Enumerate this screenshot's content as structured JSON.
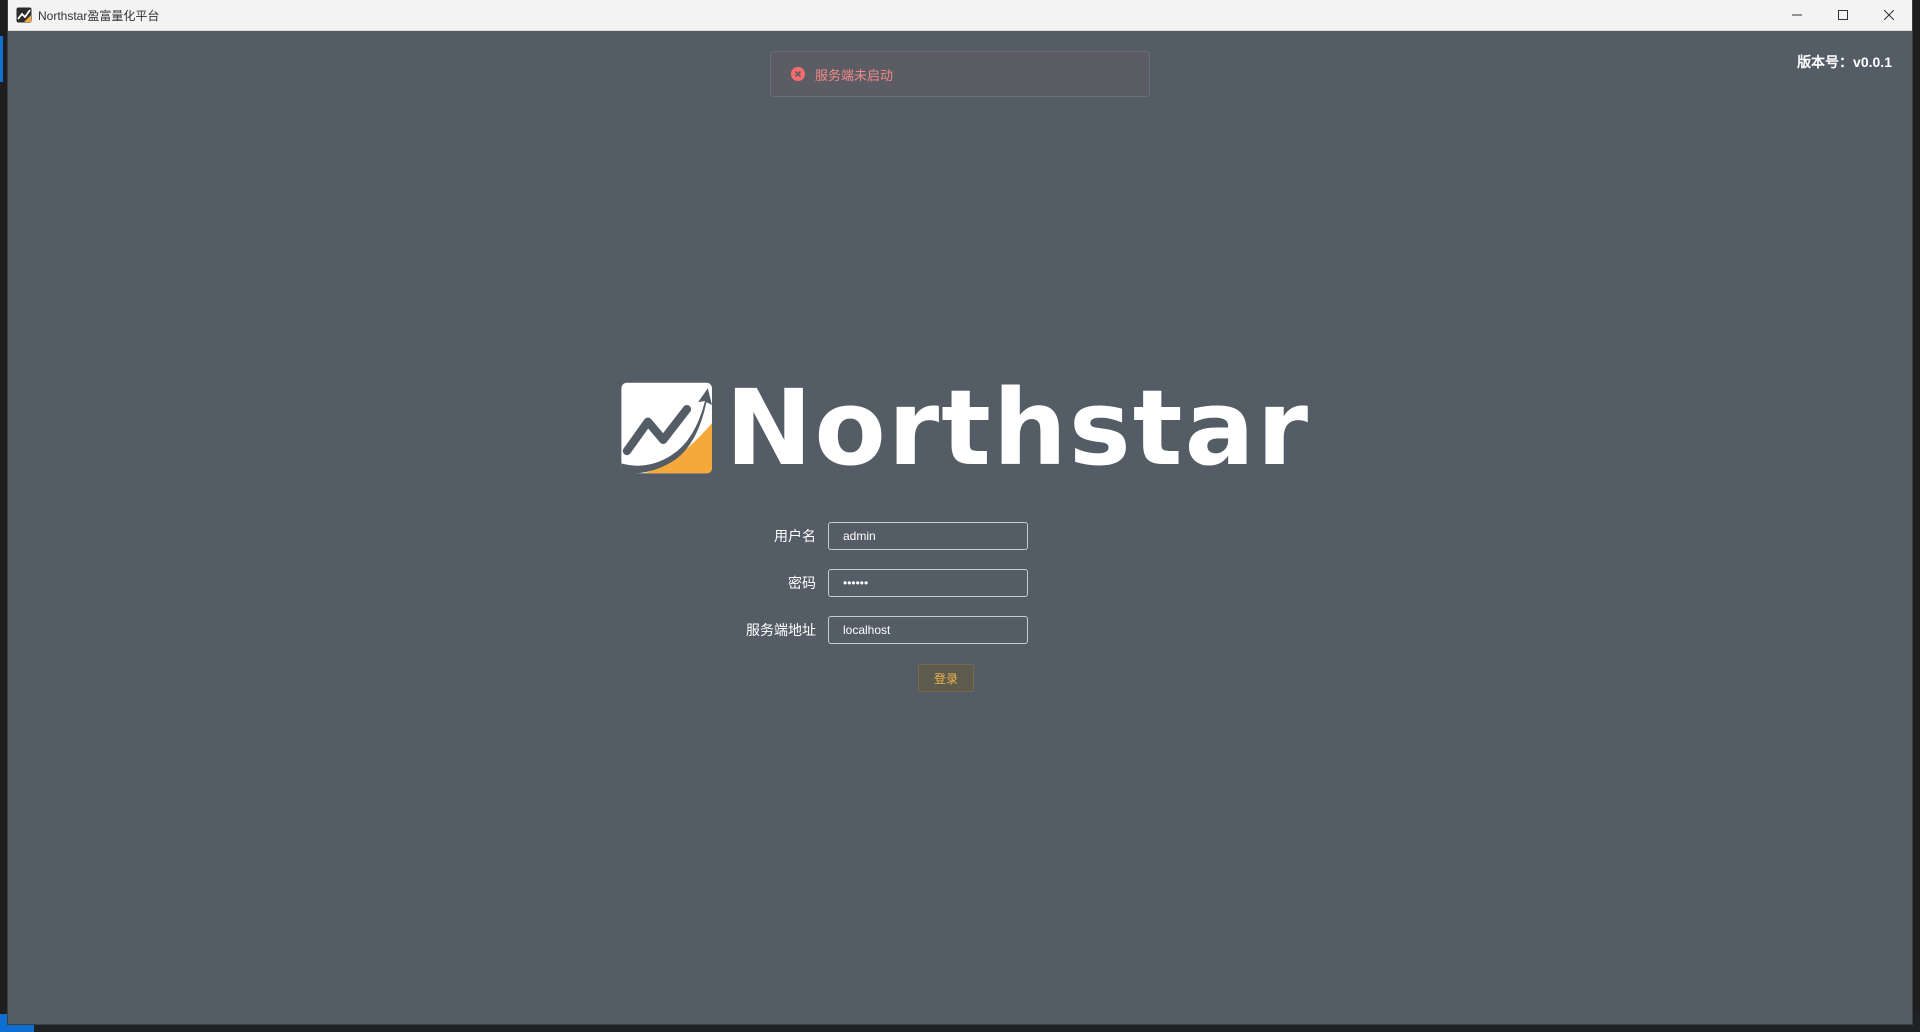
{
  "window": {
    "title": "Northstar盈富量化平台",
    "controls": [
      "minimize",
      "maximize",
      "close"
    ]
  },
  "header": {
    "version_label": "版本号：v0.0.1"
  },
  "toast": {
    "type": "error",
    "message": "服务端未启动",
    "icon": "error-circle-icon",
    "color": "#f56c6c"
  },
  "logo": {
    "wordmark": "Northstar",
    "mark_icon": "rising-chart-icon",
    "accent": "#f5a93b"
  },
  "form": {
    "username": {
      "label": "用户名",
      "value": "admin"
    },
    "password": {
      "label": "密码",
      "value": "••••••"
    },
    "server": {
      "label": "服务端地址",
      "value": "localhost"
    },
    "submit_label": "登录"
  },
  "colors": {
    "background": "#545c66",
    "button_text": "#f0b44c"
  }
}
